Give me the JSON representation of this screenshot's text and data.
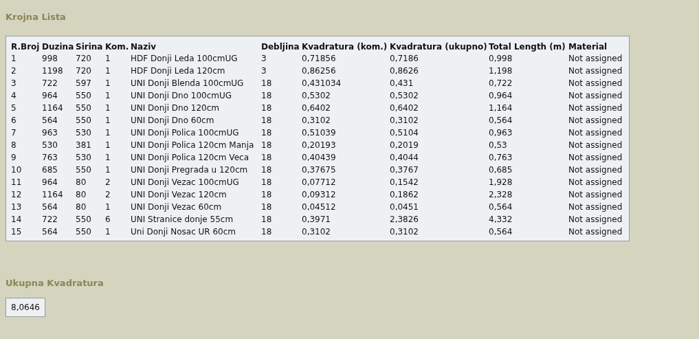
{
  "title": "Krojna Lista",
  "table": {
    "columns": [
      "R.Broj",
      "Duzina",
      "Sirina",
      "Kom.",
      "Naziv",
      "Debljina",
      "Kvadratura (kom.)",
      "Kvadratura (ukupno)",
      "Total Length (m)",
      "Material"
    ],
    "rows": [
      [
        "1",
        "998",
        "720",
        "1",
        "HDF Donji Leda 100cmUG",
        "3",
        "0,71856",
        "0,7186",
        "0,998",
        "Not assigned"
      ],
      [
        "2",
        "1198",
        "720",
        "1",
        "HDF Donji Leda 120cm",
        "3",
        "0,86256",
        "0,8626",
        "1,198",
        "Not assigned"
      ],
      [
        "3",
        "722",
        "597",
        "1",
        "UNI Donji Blenda 100cmUG",
        "18",
        "0,431034",
        "0,431",
        "0,722",
        "Not assigned"
      ],
      [
        "4",
        "964",
        "550",
        "1",
        "UNI Donji Dno 100cmUG",
        "18",
        "0,5302",
        "0,5302",
        "0,964",
        "Not assigned"
      ],
      [
        "5",
        "1164",
        "550",
        "1",
        "UNI Donji Dno 120cm",
        "18",
        "0,6402",
        "0,6402",
        "1,164",
        "Not assigned"
      ],
      [
        "6",
        "564",
        "550",
        "1",
        "UNI Donji Dno 60cm",
        "18",
        "0,3102",
        "0,3102",
        "0,564",
        "Not assigned"
      ],
      [
        "7",
        "963",
        "530",
        "1",
        "UNI Donji Polica 100cmUG",
        "18",
        "0,51039",
        "0,5104",
        "0,963",
        "Not assigned"
      ],
      [
        "8",
        "530",
        "381",
        "1",
        "UNI Donji Polica 120cm Manja",
        "18",
        "0,20193",
        "0,2019",
        "0,53",
        "Not assigned"
      ],
      [
        "9",
        "763",
        "530",
        "1",
        "UNI Donji Polica 120cm Veca",
        "18",
        "0,40439",
        "0,4044",
        "0,763",
        "Not assigned"
      ],
      [
        "10",
        "685",
        "550",
        "1",
        "UNI Donji Pregrada u 120cm",
        "18",
        "0,37675",
        "0,3767",
        "0,685",
        "Not assigned"
      ],
      [
        "11",
        "964",
        "80",
        "2",
        "UNI Donji Vezac 100cmUG",
        "18",
        "0,07712",
        "0,1542",
        "1,928",
        "Not assigned"
      ],
      [
        "12",
        "1164",
        "80",
        "2",
        "UNI Donji Vezac 120cm",
        "18",
        "0,09312",
        "0,1862",
        "2,328",
        "Not assigned"
      ],
      [
        "13",
        "564",
        "80",
        "1",
        "UNI Donji Vezac 60cm",
        "18",
        "0,04512",
        "0,0451",
        "0,564",
        "Not assigned"
      ],
      [
        "14",
        "722",
        "550",
        "6",
        "UNI Stranice donje 55cm",
        "18",
        "0,3971",
        "2,3826",
        "4,332",
        "Not assigned"
      ],
      [
        "15",
        "564",
        "550",
        "1",
        "Uni Donji Nosac UR 60cm",
        "18",
        "0,3102",
        "0,3102",
        "0,564",
        "Not assigned"
      ]
    ]
  },
  "total": {
    "title": "Ukupna Kvadratura",
    "value": "8,0646"
  }
}
